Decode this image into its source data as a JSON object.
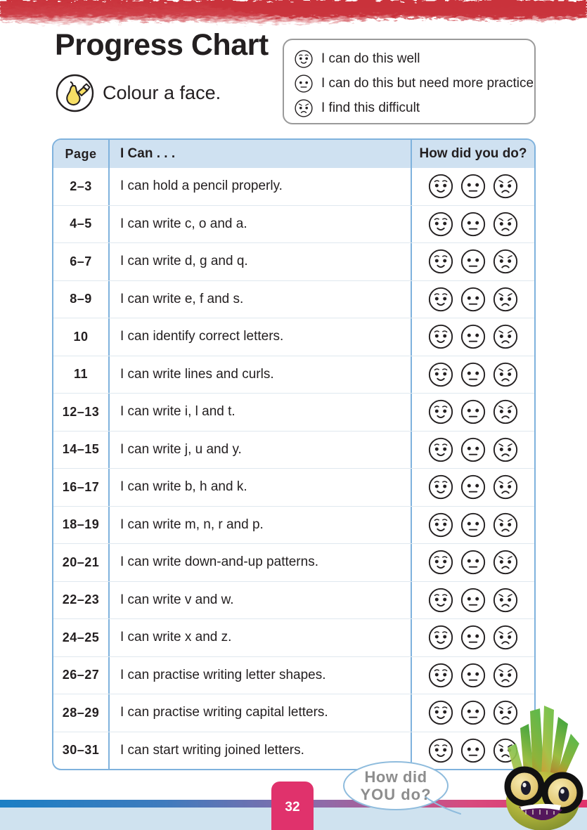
{
  "header": {
    "title": "Progress Chart",
    "instruction": "Colour a face.",
    "instruction_icon": "pear-paint-icon"
  },
  "legend": {
    "items": [
      {
        "face": "happy",
        "label": "I can do this well"
      },
      {
        "face": "neutral",
        "label": "I can do this but need more practice"
      },
      {
        "face": "sad",
        "label": "I find this difficult"
      }
    ]
  },
  "table": {
    "columns": [
      "Page",
      "I Can . . .",
      "How did you do?"
    ],
    "faces": [
      "happy",
      "neutral",
      "sad"
    ],
    "rows": [
      {
        "page": "2–3",
        "can": "I can hold a pencil properly."
      },
      {
        "page": "4–5",
        "can": "I can write c, o and a."
      },
      {
        "page": "6–7",
        "can": "I can write d, g and q."
      },
      {
        "page": "8–9",
        "can": "I can write e, f and s."
      },
      {
        "page": "10",
        "can": "I can identify correct letters."
      },
      {
        "page": "11",
        "can": "I can write lines and curls."
      },
      {
        "page": "12–13",
        "can": "I can write i, l and t."
      },
      {
        "page": "14–15",
        "can": "I can write j, u and y."
      },
      {
        "page": "16–17",
        "can": "I can write b, h and k."
      },
      {
        "page": "18–19",
        "can": "I can write m, n, r and p."
      },
      {
        "page": "20–21",
        "can": "I can write down-and-up patterns."
      },
      {
        "page": "22–23",
        "can": "I can write v and w."
      },
      {
        "page": "24–25",
        "can": "I can write x and z."
      },
      {
        "page": "26–27",
        "can": "I can practise writing letter shapes."
      },
      {
        "page": "28–29",
        "can": "I can practise writing capital letters."
      },
      {
        "page": "30–31",
        "can": "I can start writing joined letters."
      }
    ]
  },
  "footer": {
    "page_number": "32",
    "speech_line1": "How did",
    "speech_line2": "YOU do?",
    "character": "turnip-with-glasses"
  },
  "colors": {
    "banner_red": "#c9313a",
    "table_border": "#7fb2dd",
    "table_header_fill": "#cfe1f1",
    "row_divider": "#dfe8ef",
    "page_tab_pink": "#e0326c",
    "footer_band_blue": "#cfe2ef",
    "legend_border": "#9a9a9a",
    "text_dark": "#231f20",
    "bubble_text_grey": "#8d8d8d",
    "pear_yellow": "#f7df65"
  }
}
